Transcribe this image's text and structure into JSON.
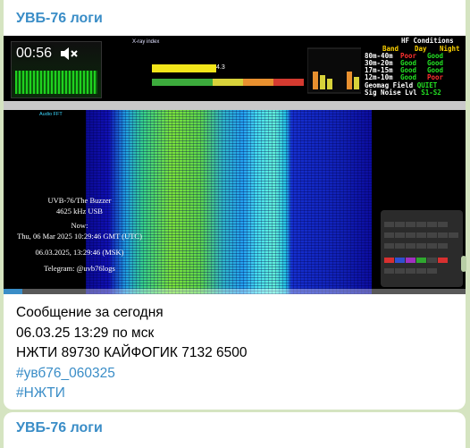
{
  "channel": {
    "name": "УВБ-76 логи"
  },
  "video": {
    "elapsed": "00:56",
    "xray_title": "X-ray index",
    "xray_value": "4.3",
    "hf": {
      "title": "HF Conditions",
      "header_band": "Band",
      "header_day": "Day",
      "header_night": "Night",
      "rows": [
        {
          "band": "80m-40m",
          "day": "Poor",
          "night": "Good"
        },
        {
          "band": "30m-20m",
          "day": "Good",
          "night": "Good"
        },
        {
          "band": "17m-15m",
          "day": "Good",
          "night": "Good"
        },
        {
          "band": "12m-10m",
          "day": "Good",
          "night": "Poor"
        }
      ],
      "geomag_label": "Geomag Field",
      "geomag_value": "QUIET",
      "noise_label": "Sig Noise Lvl",
      "noise_value": "S1-S2"
    },
    "audio_fft": "Audio FFT",
    "station": "UVB-76/The Buzzer",
    "frequency": "4625 kHz USB",
    "now_label": "Now:",
    "utc_time": "Thu, 06 Mar 2025 10:29:46 GMT (UTC)",
    "msk_time": "06.03.2025, 13:29:46 (MSK)",
    "telegram": "Telegram: @uvb76logs",
    "progress_fraction": 0.04
  },
  "message": {
    "line1": "Сообщение за сегодня",
    "line2": "06.03.25 13:29 по мск",
    "line3": "НЖТИ 89730 КАЙФОГИК 7132 6500",
    "tag1": "#увб76_060325",
    "tag2": "#НЖТИ"
  },
  "next_post": {
    "channel_name": "УВБ-76 логи"
  },
  "colors": {
    "accent": "#3a8dc7",
    "chat_bg": "#d5e4c1",
    "good": "#23e223",
    "poor": "#ff3030"
  }
}
